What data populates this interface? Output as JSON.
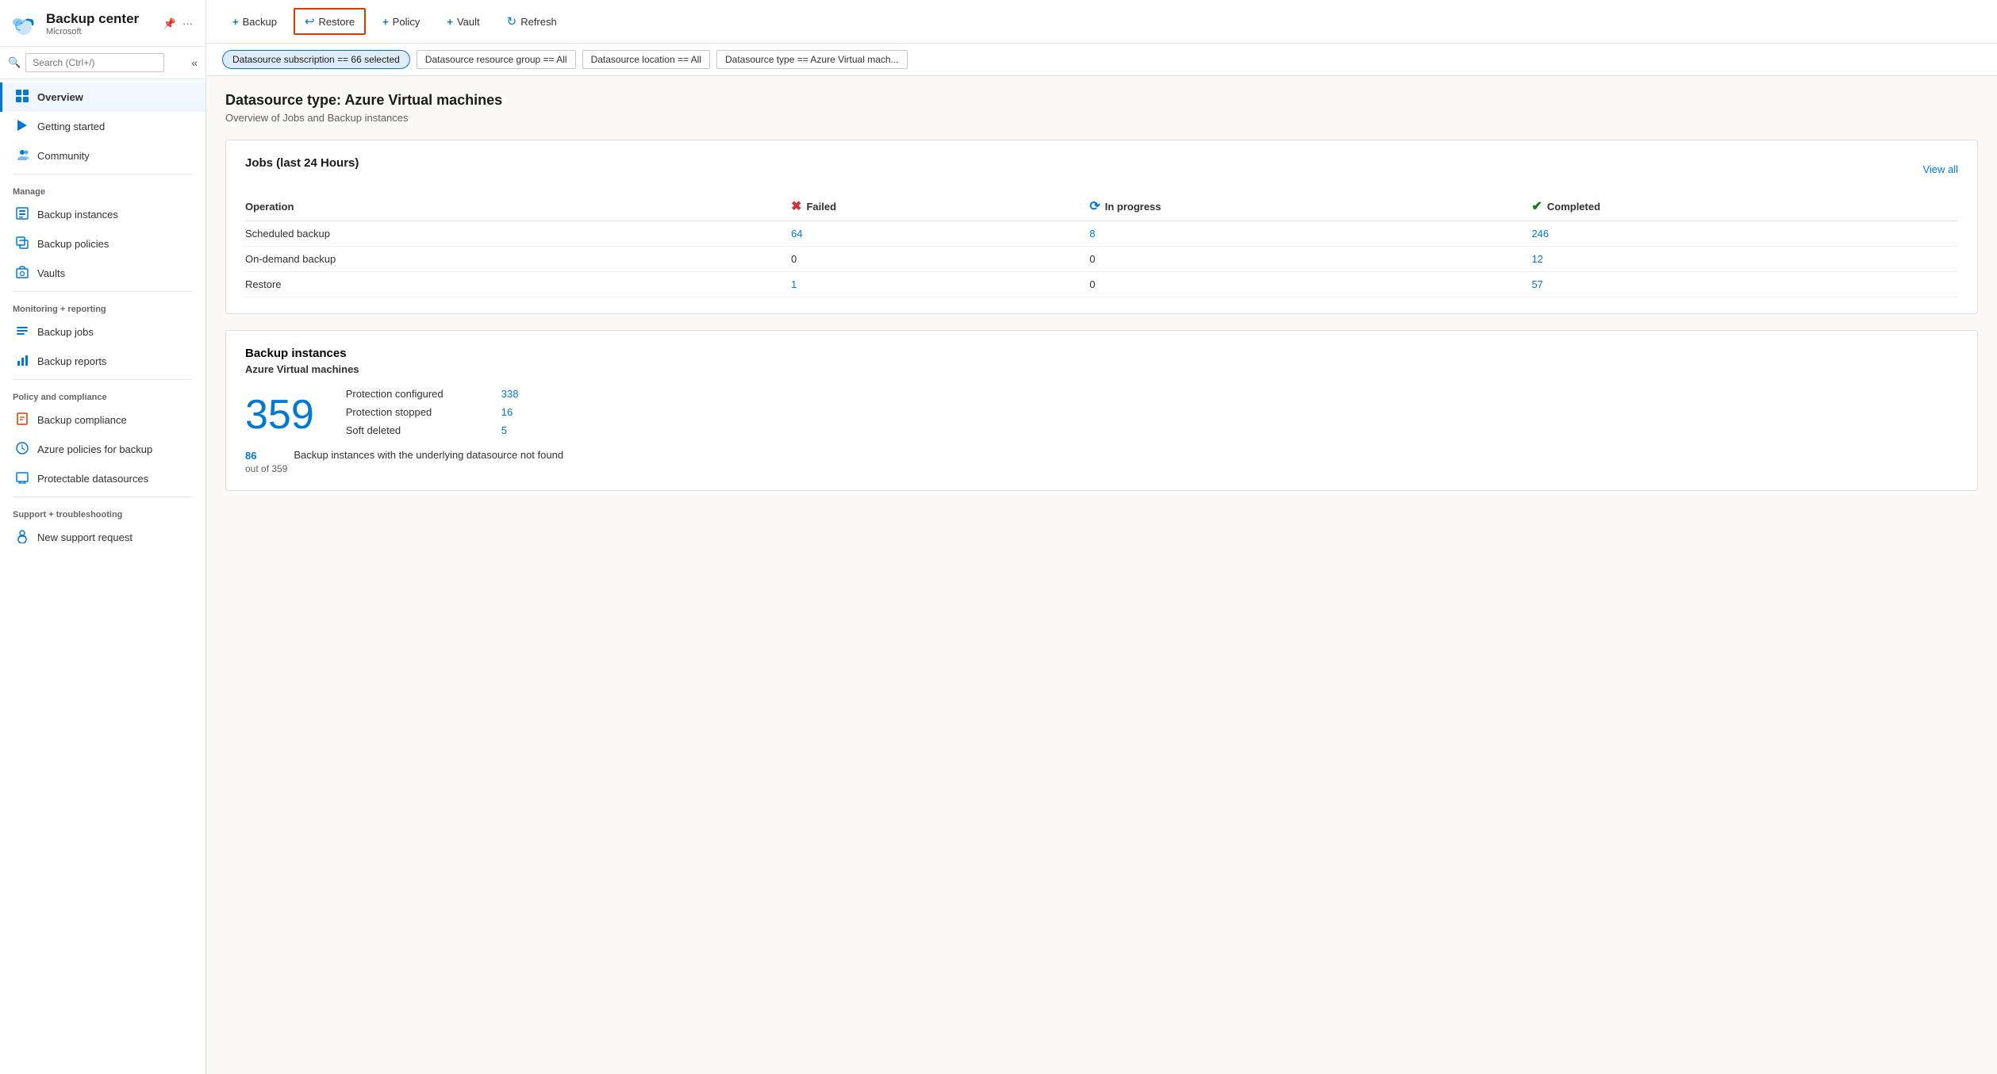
{
  "sidebar": {
    "app_title": "Backup center",
    "app_subtitle": "Microsoft",
    "search_placeholder": "Search (Ctrl+/)",
    "collapse_icon": "«",
    "nav": {
      "overview": "Overview",
      "getting_started": "Getting started",
      "community": "Community",
      "sections": {
        "manage": "Manage",
        "monitoring": "Monitoring + reporting",
        "policy": "Policy and compliance",
        "support": "Support + troubleshooting"
      },
      "manage_items": [
        {
          "id": "backup-instances",
          "label": "Backup instances"
        },
        {
          "id": "backup-policies",
          "label": "Backup policies"
        },
        {
          "id": "vaults",
          "label": "Vaults"
        }
      ],
      "monitoring_items": [
        {
          "id": "backup-jobs",
          "label": "Backup jobs"
        },
        {
          "id": "backup-reports",
          "label": "Backup reports"
        }
      ],
      "policy_items": [
        {
          "id": "backup-compliance",
          "label": "Backup compliance"
        },
        {
          "id": "azure-policies",
          "label": "Azure policies for backup"
        },
        {
          "id": "protectable-datasources",
          "label": "Protectable datasources"
        }
      ],
      "support_items": [
        {
          "id": "new-support",
          "label": "New support request"
        }
      ]
    }
  },
  "toolbar": {
    "backup_label": "+ Backup",
    "restore_label": "↩ Restore",
    "policy_label": "+ Policy",
    "vault_label": "+ Vault",
    "refresh_label": "↻ Refresh"
  },
  "filters": {
    "subscription": "Datasource subscription == 66 selected",
    "resource_group": "Datasource resource group == All",
    "location": "Datasource location == All",
    "type": "Datasource type == Azure Virtual mach..."
  },
  "page": {
    "title": "Datasource type: Azure Virtual machines",
    "subtitle": "Overview of Jobs and Backup instances"
  },
  "jobs_card": {
    "title": "Jobs (last 24 Hours)",
    "view_all": "View all",
    "columns": {
      "operation": "Operation",
      "failed": "Failed",
      "in_progress": "In progress",
      "completed": "Completed"
    },
    "rows": [
      {
        "operation": "Scheduled backup",
        "failed": "64",
        "failed_link": true,
        "in_progress": "8",
        "in_progress_link": true,
        "completed": "246",
        "completed_link": true
      },
      {
        "operation": "On-demand backup",
        "failed": "0",
        "failed_link": false,
        "in_progress": "0",
        "in_progress_link": false,
        "completed": "12",
        "completed_link": true
      },
      {
        "operation": "Restore",
        "failed": "1",
        "failed_link": true,
        "in_progress": "0",
        "in_progress_link": false,
        "completed": "57",
        "completed_link": true
      }
    ]
  },
  "backup_instances_card": {
    "title": "Backup instances",
    "subtitle": "Azure Virtual machines",
    "total_count": "359",
    "stats": [
      {
        "label": "Protection configured",
        "value": "338"
      },
      {
        "label": "Protection stopped",
        "value": "16"
      },
      {
        "label": "Soft deleted",
        "value": "5"
      }
    ],
    "footer_num": "86",
    "footer_sub": "out of 359",
    "footer_text": "Backup instances with the underlying datasource not found"
  }
}
